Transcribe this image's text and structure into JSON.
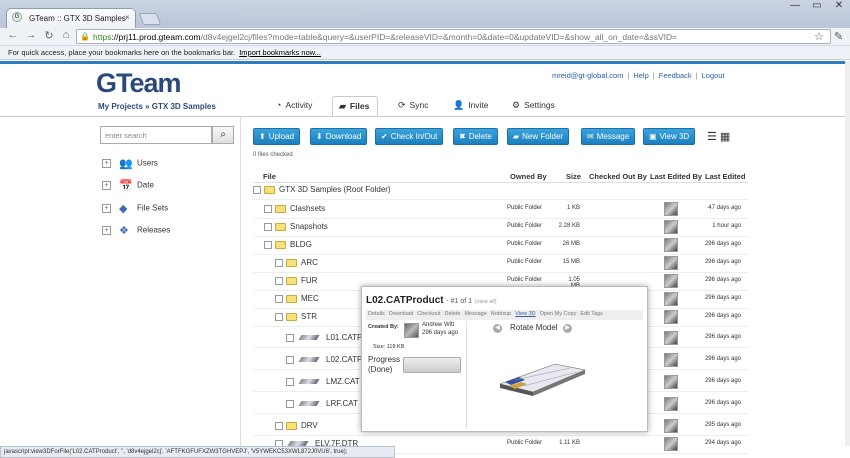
{
  "browser": {
    "tab_title": "GTeam :: GTX 3D Samples",
    "tab_close": "×",
    "window_buttons": [
      "—",
      "▭",
      "✕"
    ],
    "url_https": "https",
    "url_host": "://prj11.prod.gteam.com",
    "url_rest": "/d8v4ejgel2cj/files?mode=table&query=&userPID=&releaseVID=&month=0&date=0&updateVID=&show_all_on_date=&ssVID=",
    "bookmarks_text": "For quick access, place your bookmarks here on the bookmarks bar.",
    "bookmarks_link": "Import bookmarks now...",
    "status_url": "javascript:view3DForFile('L02.CATProduct', '', 'd8v4ejgel2cj', 'AFTFKGFUFXZW3TGHVEPJ', 'V5YWEKC53XWL872J0VU6', true);"
  },
  "app": {
    "logo_left": "G",
    "logo_right": "Team",
    "breadcrumb": "My Projects » GTX 3D Samples",
    "user_email": "mreid@gt-global.com",
    "user_links": [
      "Help",
      "Feedback",
      "Logout"
    ],
    "separator": "|",
    "tabs": [
      {
        "icon": "◔",
        "label": "Activity"
      },
      {
        "icon": "▰",
        "label": "Files"
      },
      {
        "icon": "⟳",
        "label": "Sync"
      },
      {
        "icon": "👤",
        "label": "Invite"
      },
      {
        "icon": "⚙",
        "label": "Settings"
      }
    ]
  },
  "sidebar": {
    "search_placeholder": "enter search",
    "search_icon": "⌕",
    "facets": [
      {
        "label": "Users",
        "icon": "users-icon",
        "glyph": "👥"
      },
      {
        "label": "Date",
        "icon": "calendar-icon",
        "glyph": "📅"
      },
      {
        "label": "File Sets",
        "icon": "cube-icon",
        "glyph": "◆"
      },
      {
        "label": "Releases",
        "icon": "box-icon",
        "glyph": "❖"
      }
    ],
    "plus": "+"
  },
  "actions": {
    "buttons": [
      {
        "icon": "⬆",
        "label": "Upload"
      },
      {
        "icon": "⬇",
        "label": "Download"
      },
      {
        "icon": "✔",
        "label": "Check In/Out"
      },
      {
        "icon": "✖",
        "label": "Delete"
      },
      {
        "icon": "▰",
        "label": "New Folder"
      },
      {
        "icon": "✉",
        "label": "Message"
      },
      {
        "icon": "▣",
        "label": "View 3D"
      }
    ],
    "view_toggle": "☰ ▦",
    "files_checked": "0 files checked"
  },
  "table": {
    "headers": [
      "File",
      "Owned By",
      "Size",
      "Checked Out By",
      "Last Edited By",
      "Last Edited"
    ],
    "rows": [
      {
        "name": "GTX 3D Samples (Root Folder)",
        "type": "folder",
        "owned": "",
        "size": "",
        "ago": ""
      },
      {
        "name": "Clashsets",
        "type": "folder",
        "owned": "Public Folder",
        "size": "1 KB",
        "ago": "47 days ago"
      },
      {
        "name": "Snapshots",
        "type": "folder",
        "owned": "Public Folder",
        "size": "2.28 KB",
        "ago": "1 hour ago"
      },
      {
        "name": "BLDG",
        "type": "folder",
        "owned": "Public Folder",
        "size": "26 MB",
        "ago": "296 days ago"
      },
      {
        "name": "ARC",
        "type": "folder",
        "owned": "Public Folder",
        "size": "15 MB",
        "ago": "296 days ago"
      },
      {
        "name": "FUR",
        "type": "folder",
        "owned": "Public Folder",
        "size": "1.05 MB",
        "ago": "296 days ago"
      },
      {
        "name": "MEC",
        "type": "folder",
        "owned": "",
        "size": "",
        "ago": "296 days ago"
      },
      {
        "name": "STR",
        "type": "folder",
        "owned": "",
        "size": "",
        "ago": "296 days ago"
      },
      {
        "name": "L01.CATP",
        "type": "part",
        "owned": "",
        "size": "",
        "ago": "296 days ago"
      },
      {
        "name": "L02.CATP",
        "type": "part",
        "owned": "",
        "size": "",
        "ago": "296 days ago"
      },
      {
        "name": "LMZ.CAT",
        "type": "part",
        "owned": "",
        "size": "",
        "ago": "296 days ago"
      },
      {
        "name": "LRF.CAT",
        "type": "part",
        "owned": "",
        "size": "",
        "ago": "296 days ago"
      },
      {
        "name": "DRV",
        "type": "folder",
        "owned": "",
        "size": "",
        "ago": "295 days ago"
      },
      {
        "name": "ELV.7F.DTR",
        "type": "part",
        "owned": "Public Folder",
        "size": "1.11 KB",
        "ago": "294 days ago"
      }
    ]
  },
  "popup": {
    "title": "L02.CATProduct",
    "subtitle": "- #1 of 1",
    "view_all": "(view all)",
    "menu": [
      "Details",
      "Download",
      "Checkout",
      "Delete",
      "Message",
      "Notrixup",
      "View 3D",
      "Open My Copy",
      "Edit Tags"
    ],
    "created_by_label": "Created By:",
    "author": "Andrew Witt",
    "date": "296 days ago",
    "size": "Size: 118 KB",
    "progress": "Progress (Done)",
    "rotate": "Rotate Model"
  }
}
